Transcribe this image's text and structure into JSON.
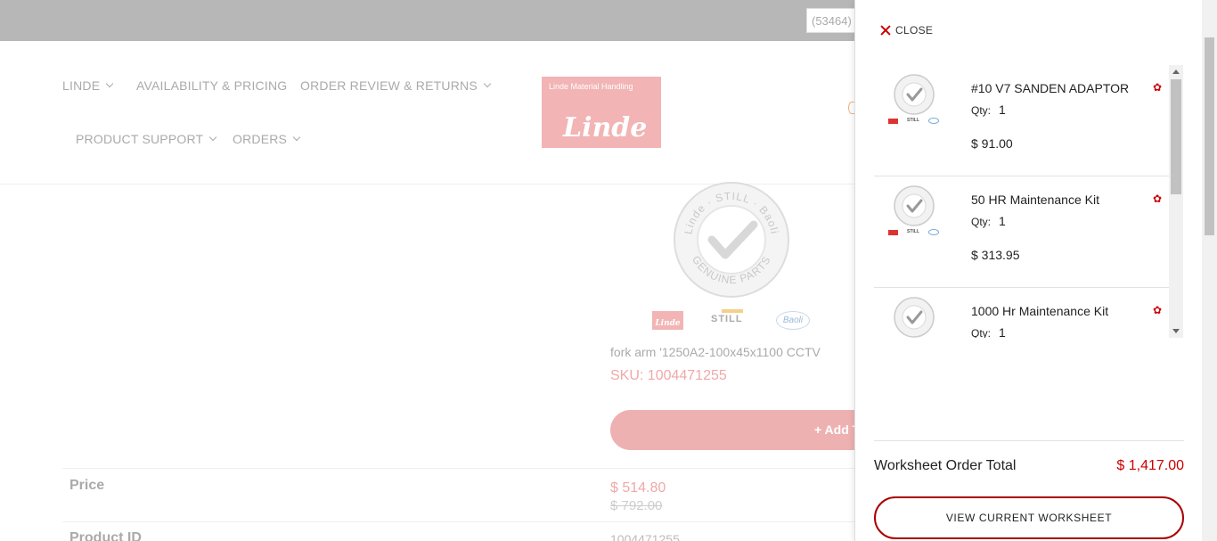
{
  "topbar": {
    "account_text": "(53464)"
  },
  "nav": {
    "items": [
      {
        "label": "LINDE",
        "dropdown": true
      },
      {
        "label": "AVAILABILITY & PRICING",
        "dropdown": false
      },
      {
        "label": "ORDER REVIEW & RETURNS",
        "dropdown": true
      },
      {
        "label": "PRODUCT SUPPORT",
        "dropdown": true
      },
      {
        "label": "ORDERS",
        "dropdown": true
      }
    ]
  },
  "logo": {
    "subtitle": "Linde Material Handling",
    "wordmark": "Linde"
  },
  "product": {
    "badge": {
      "top_text": "Linde · STILL · Baoli",
      "bottom_text": "GENUINE PARTS"
    },
    "brands": [
      "Linde",
      "STILL",
      "Baoli"
    ],
    "name": "fork arm '1250A2-100x45x1100 CCTV",
    "sku": "SKU: 1004471255",
    "add_button": "+ Add T",
    "specs": {
      "price_label": "Price",
      "price_current": "$ 514.80",
      "price_original": "$ 792.00",
      "product_id_label": "Product ID",
      "product_id_value": "1004471255"
    }
  },
  "worksheet": {
    "close_label": "CLOSE",
    "qty_label": "Qty:",
    "items": [
      {
        "name": "#10 V7 SANDEN ADAPTOR",
        "qty": "1",
        "price": "$ 91.00"
      },
      {
        "name": "50 HR Maintenance Kit",
        "qty": "1",
        "price": "$ 313.95"
      },
      {
        "name": "1000 Hr Maintenance Kit",
        "qty": "1",
        "price": ""
      }
    ],
    "total_label": "Worksheet Order Total",
    "total_value": "$ 1,417.00",
    "view_button": "VIEW CURRENT WORKSHEET"
  },
  "colors": {
    "accent": "#cc0000",
    "dimmed_accent": "#f2b4b4",
    "topbar": "#b7b7b7"
  }
}
